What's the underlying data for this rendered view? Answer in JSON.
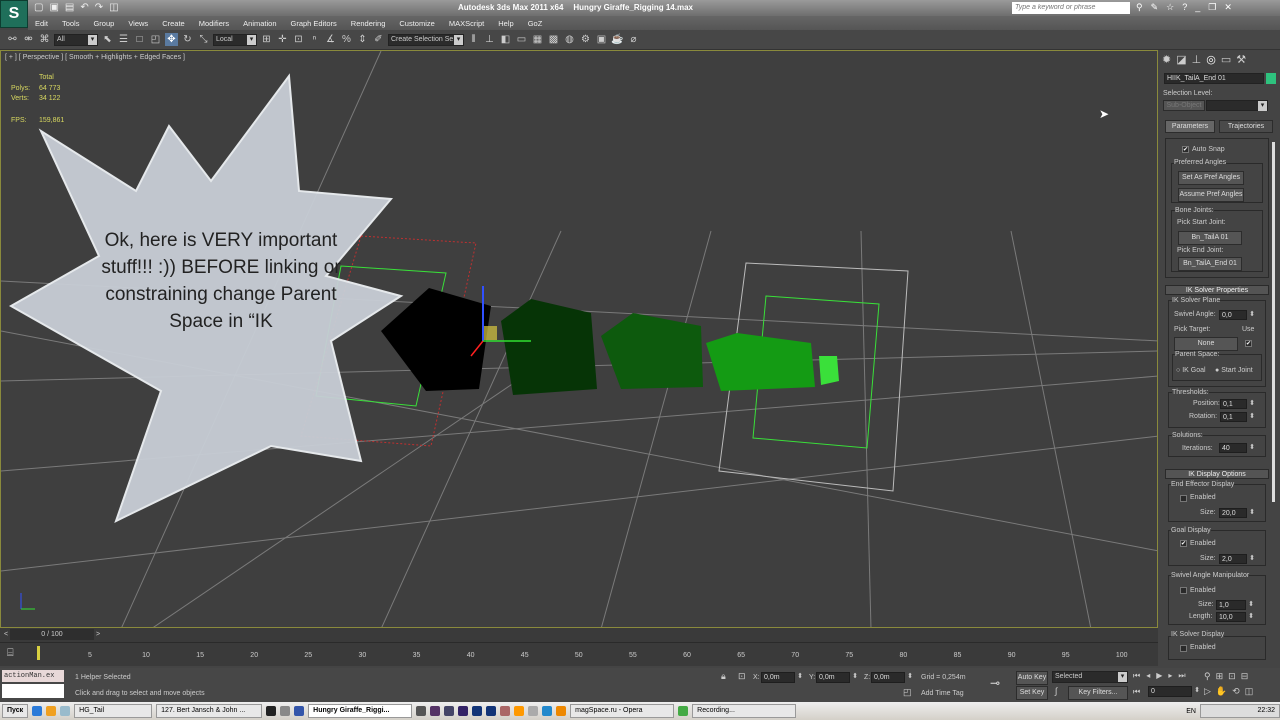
{
  "titlebar": {
    "app": "Autodesk 3ds Max  2011 x64",
    "file": "Hungry Giraffe_Rigging 14.max",
    "search_placeholder": "Type a keyword or phrase"
  },
  "menu": [
    "Edit",
    "Tools",
    "Group",
    "Views",
    "Create",
    "Modifiers",
    "Animation",
    "Graph Editors",
    "Rendering",
    "Customize",
    "MAXScript",
    "Help",
    "GoZ"
  ],
  "toolbar": {
    "filter": "All",
    "coord": "Local",
    "selection_set": "Create Selection Se"
  },
  "viewport": {
    "label": "[ + ] [ Perspective ] [ Smooth + Highlights + Edged Faces ]",
    "stats": {
      "total_label": "Total",
      "polys_label": "Polys:",
      "polys": "64 773",
      "verts_label": "Verts:",
      "verts": "34 122",
      "fps_label": "FPS:",
      "fps": "159,861"
    },
    "bubble_text": "Ok, here is VERY important stuff!!! :)) BEFORE linking or constraining change Parent Space in “IK"
  },
  "command_panel": {
    "object_name": "HIIK_TailA_End 01",
    "object_color": "#2ec27e",
    "selection_level_label": "Selection Level:",
    "sub_object": "Sub-Object",
    "tabs": [
      "Parameters",
      "Trajectories"
    ],
    "auto_snap": "Auto Snap",
    "preferred_angles": "Preferred Angles",
    "set_as_pref": "Set As Pref Angles",
    "assume_pref": "Assume Pref Angles",
    "bone_joints": "Bone Joints:",
    "pick_start": "Pick Start Joint:",
    "start_joint": "Bn_TailA 01",
    "pick_end": "Pick End Joint:",
    "end_joint": "Bn_TailA_End 01",
    "ik_solver_props": "IK Solver Properties",
    "ik_solver_plane": "IK Solver Plane",
    "swivel_label": "Swivel Angle:",
    "swivel": "0,0",
    "pick_target": "Pick Target:",
    "use": "Use",
    "none": "None",
    "parent_space": "Parent Space:",
    "ik_goal": "IK Goal",
    "start_joint_radio": "Start Joint",
    "thresholds": "Thresholds:",
    "position_label": "Position:",
    "position": "0,1",
    "rotation_label": "Rotation:",
    "rotation": "0,1",
    "solutions": "Solutions:",
    "iterations_label": "Iterations:",
    "iterations": "40",
    "ik_display": "IK Display Options",
    "end_effector": "End Effector Display",
    "enabled": "Enabled",
    "size_label": "Size:",
    "ee_size": "20,0",
    "goal_display": "Goal Display",
    "goal_size": "2,0",
    "swivel_manip": "Swivel Angle Manipulator",
    "sm_size": "1,0",
    "length_label": "Length:",
    "sm_length": "10,0",
    "ik_solver_display": "IK Solver Display"
  },
  "timeline": {
    "frame": "0 / 100",
    "ticks": [
      "5",
      "10",
      "15",
      "20",
      "25",
      "30",
      "35",
      "40",
      "45",
      "50",
      "55",
      "60",
      "65",
      "70",
      "75",
      "80",
      "85",
      "90",
      "95",
      "100"
    ]
  },
  "status": {
    "script_listener": "actionMan.ex",
    "selected": "1 Helper Selected",
    "prompt": "Click and drag to select and move objects",
    "x_label": "X:",
    "x": "0,0m",
    "y_label": "Y:",
    "y": "0,0m",
    "z_label": "Z:",
    "z": "0,0m",
    "grid": "Grid = 0,254m",
    "add_time_tag": "Add Time Tag",
    "auto_key": "Auto Key",
    "set_key": "Set Key",
    "key_mode": "Selected",
    "key_filters": "Key Filters...",
    "current_frame": "0"
  },
  "taskbar": {
    "start": "Пуск",
    "tasks": [
      "HG_Tail",
      "127. Bert Jansch & John ...",
      "Hungry Giraffe_Riggi...",
      "magSpace.ru - Opera",
      "Recording..."
    ],
    "lang": "EN",
    "clock": "22:32"
  }
}
